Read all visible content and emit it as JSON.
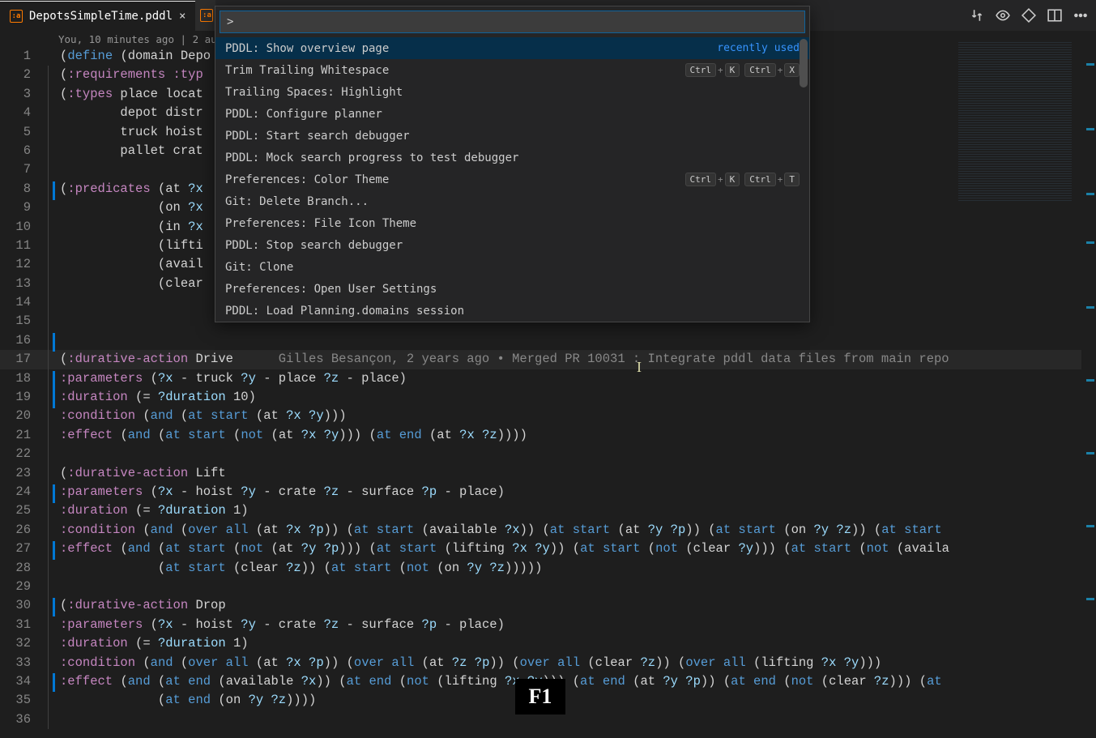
{
  "tab": {
    "filename": "DepotsSimpleTime.pddl"
  },
  "codelens_top": "You, 10 minutes ago | 2 au",
  "palette": {
    "prompt": ">",
    "items": [
      {
        "label": "PDDL: Show overview page",
        "selected": true,
        "hint": "recently used"
      },
      {
        "label": "Trim Trailing Whitespace",
        "keys": [
          [
            "Ctrl",
            "K"
          ],
          [
            "Ctrl",
            "X"
          ]
        ]
      },
      {
        "label": "Trailing Spaces: Highlight"
      },
      {
        "label": "PDDL: Configure planner"
      },
      {
        "label": "PDDL: Start search debugger"
      },
      {
        "label": "PDDL: Mock search progress to test debugger"
      },
      {
        "label": "Preferences: Color Theme",
        "keys": [
          [
            "Ctrl",
            "K"
          ],
          [
            "Ctrl",
            "T"
          ]
        ]
      },
      {
        "label": "Git: Delete Branch..."
      },
      {
        "label": "Preferences: File Icon Theme"
      },
      {
        "label": "PDDL: Stop search debugger"
      },
      {
        "label": "Git: Clone"
      },
      {
        "label": "Preferences: Open User Settings"
      },
      {
        "label": "PDDL: Load Planning.domains session"
      }
    ]
  },
  "git_lens_line17": "Gilles Besançon, 2 years ago • Merged PR 10031 : Integrate pddl data files from main repo",
  "overlay_key": "F1",
  "code": {
    "l1": "(define (domain Depo",
    "l2": "(:requirements :typ",
    "l3": "(:types place locat",
    "l4": "        depot distr",
    "l5": "        truck hoist",
    "l6": "        pallet crat",
    "l7": "",
    "l8": "(:predicates (at ?x",
    "l9": "             (on ?x",
    "l10": "             (in ?x",
    "l11": "             (lifti",
    "l12": "             (avail",
    "l13": "             (clear",
    "l14": "",
    "l15": "",
    "l16": "",
    "l17_a": "(",
    "l17_b": ":durative-action",
    "l17_c": " Drive",
    "l18": ":parameters (?x - truck ?y - place ?z - place)",
    "l19": ":duration (= ?duration 10)",
    "l20": ":condition (and (at start (at ?x ?y)))",
    "l21": ":effect (and (at start (not (at ?x ?y))) (at end (at ?x ?z))))",
    "l22": "",
    "l23": "(:durative-action Lift",
    "l24": ":parameters (?x - hoist ?y - crate ?z - surface ?p - place)",
    "l25": ":duration (= ?duration 1)",
    "l26": ":condition (and (over all (at ?x ?p)) (at start (available ?x)) (at start (at ?y ?p)) (at start (on ?y ?z)) (at start",
    "l27": ":effect (and (at start (not (at ?y ?p))) (at start (lifting ?x ?y)) (at start (not (clear ?y))) (at start (not (availa",
    "l28": "             (at start (clear ?z)) (at start (not (on ?y ?z)))))",
    "l29": "",
    "l30": "(:durative-action Drop",
    "l31": ":parameters (?x - hoist ?y - crate ?z - surface ?p - place)",
    "l32": ":duration (= ?duration 1)",
    "l33": ":condition (and (over all (at ?x ?p)) (over all (at ?z ?p)) (over all (clear ?z)) (over all (lifting ?x ?y)))",
    "l34": ":effect (and (at end (available ?x)) (at end (not (lifting ?x ?y))) (at end (at ?y ?p)) (at end (not (clear ?z))) (at",
    "l35": "             (at end (on ?y ?z))))",
    "l36": ""
  }
}
